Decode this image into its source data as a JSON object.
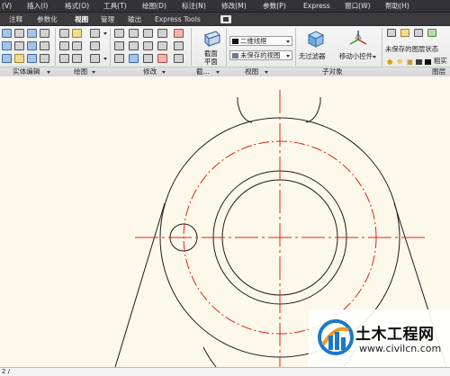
{
  "menubar": {
    "items": [
      "(V)",
      "插入(I)",
      "格式(O)",
      "工具(T)",
      "绘图(D)",
      "标注(N)",
      "修改(M)",
      "参数(P)",
      "Express",
      "窗口(W)",
      "帮助(H)"
    ]
  },
  "ribbon_tabs": {
    "items": [
      "注释",
      "参数化",
      "视图",
      "管理",
      "输出",
      "Express Tools"
    ],
    "active": "视图"
  },
  "ribbon": {
    "section_plane_label": "截面平面",
    "visual_style_value": "二维线框",
    "view_value": "未保存的视图",
    "no_filter_label": "无过滤器",
    "gizmo_label": "移动小控件",
    "layer_state_value": "未保存的图层状态",
    "layer_fragment": "粗实",
    "panel_labels": {
      "solid_edit": "实体编辑",
      "draw": "绘图",
      "modify": "修改",
      "section_short": "截...",
      "view": "视图",
      "subobject": "子对象",
      "layers": "图层"
    }
  },
  "commandline": {
    "text": "2 /"
  },
  "watermark": {
    "title": "土木工程网",
    "url": "www.civilcn.com",
    "logo_colors": {
      "blue": "#1a78c9",
      "orange": "#f29a1e"
    }
  },
  "drawing": {
    "colors": {
      "outline": "#1b1b1b",
      "centerline": "#e0201c"
    }
  }
}
